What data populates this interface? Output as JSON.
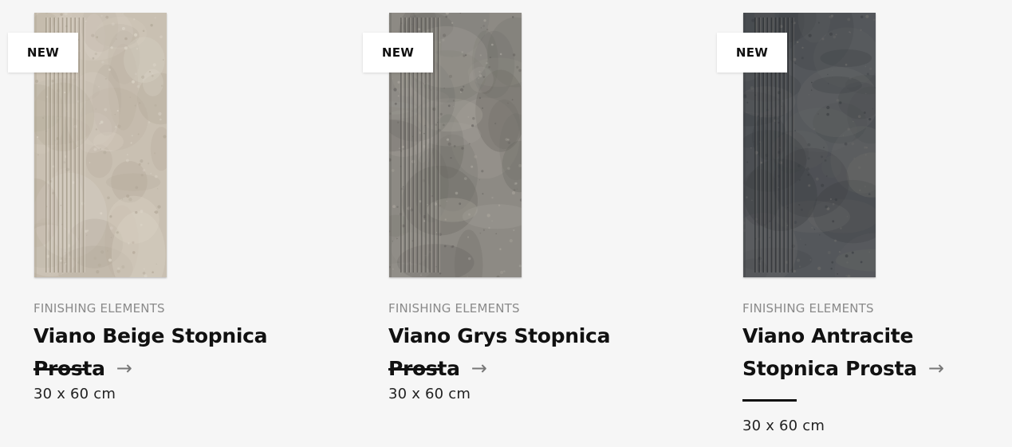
{
  "products": [
    {
      "badge": "NEW",
      "category": "FINISHING ELEMENTS",
      "title": "Viano Beige Stopnica Prosta",
      "size": "30 x 60 cm",
      "tile_colors": {
        "base": "#c9c0b2",
        "light": "#ddd6ca",
        "dark": "#b0a696",
        "groove": "#9e9484"
      }
    },
    {
      "badge": "NEW",
      "category": "FINISHING ELEMENTS",
      "title": "Viano Grys Stopnica Prosta",
      "size": "30 x 60 cm",
      "tile_colors": {
        "base": "#8d8a84",
        "light": "#aba79f",
        "dark": "#66635f",
        "groove": "#5c5955"
      }
    },
    {
      "badge": "NEW",
      "category": "FINISHING ELEMENTS",
      "title": "Viano Antracite Stopnica Prosta",
      "size": "30 x 60 cm",
      "tile_colors": {
        "base": "#54575b",
        "light": "#6c6c6a",
        "dark": "#3b3e42",
        "groove": "#2e3033"
      }
    }
  ],
  "icons": {
    "arrow": "arrow-right-icon"
  }
}
